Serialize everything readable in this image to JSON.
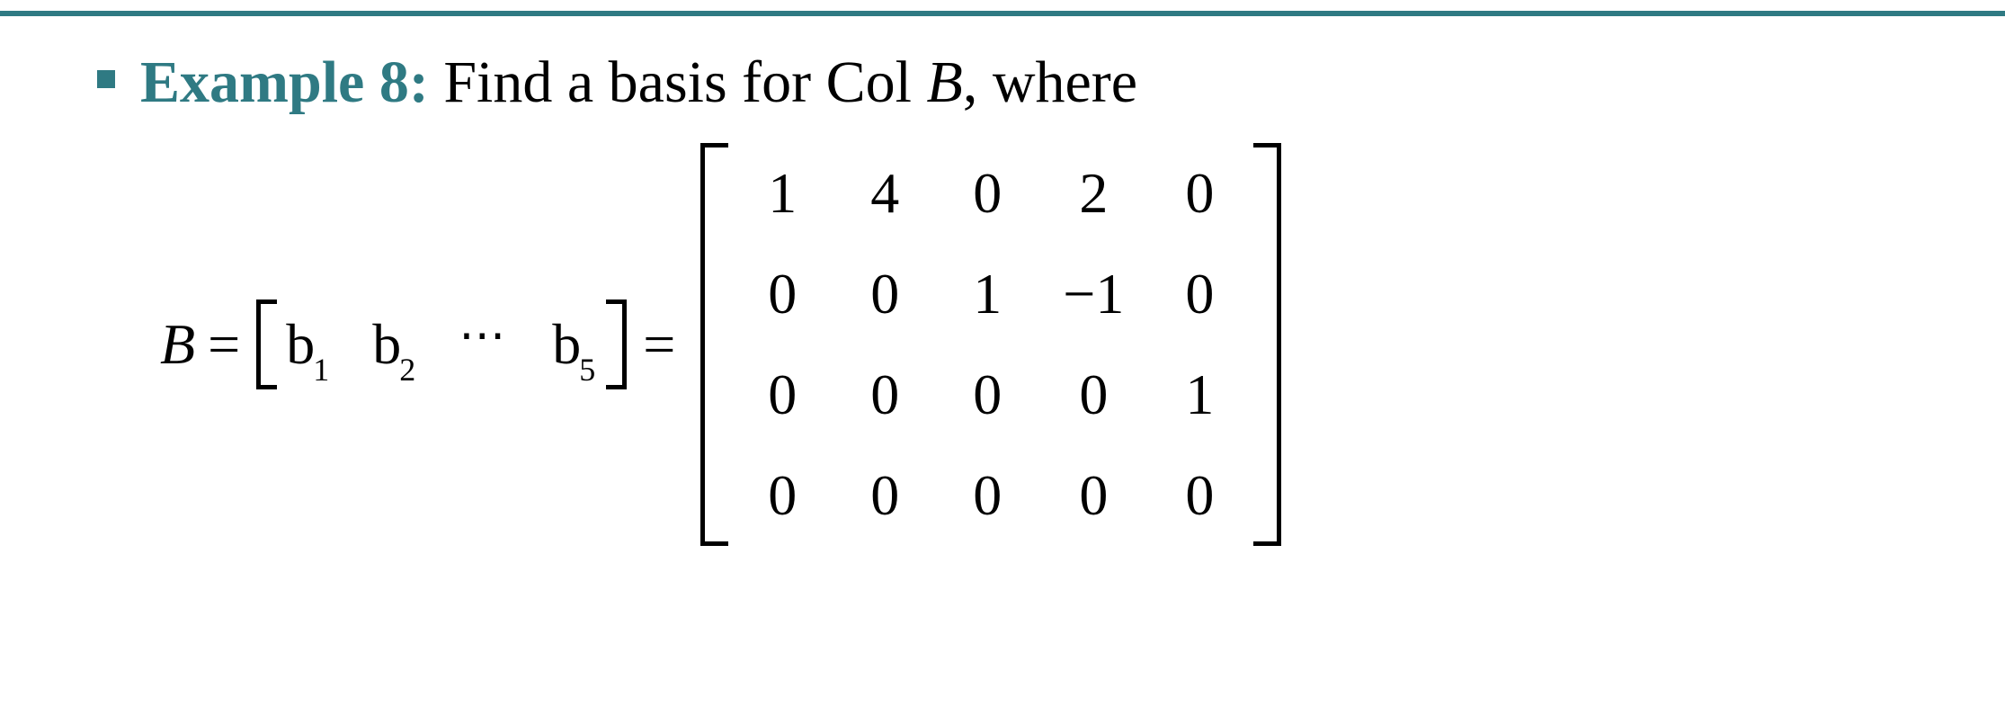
{
  "prompt": {
    "label": "Example 8:",
    "text_before": " Find a basis for Col ",
    "matrix_var": "B",
    "text_after": ", where"
  },
  "equation": {
    "lhs": "B",
    "eq": "=",
    "columns": [
      {
        "base": "b",
        "sub": "1"
      },
      {
        "base": "b",
        "sub": "2"
      },
      {
        "dots": "⋯"
      },
      {
        "base": "b",
        "sub": "5"
      }
    ],
    "eq2": "=",
    "matrix": {
      "rows": 4,
      "cols": 5,
      "values": [
        [
          "1",
          "4",
          "0",
          "2",
          "0"
        ],
        [
          "0",
          "0",
          "1",
          "−1",
          "0"
        ],
        [
          "0",
          "0",
          "0",
          "0",
          "1"
        ],
        [
          "0",
          "0",
          "0",
          "0",
          "0"
        ]
      ]
    }
  },
  "chart_data": {
    "type": "table",
    "title": "Matrix B (4×5)",
    "rows": [
      [
        1,
        4,
        0,
        2,
        0
      ],
      [
        0,
        0,
        1,
        -1,
        0
      ],
      [
        0,
        0,
        0,
        0,
        1
      ],
      [
        0,
        0,
        0,
        0,
        0
      ]
    ]
  }
}
